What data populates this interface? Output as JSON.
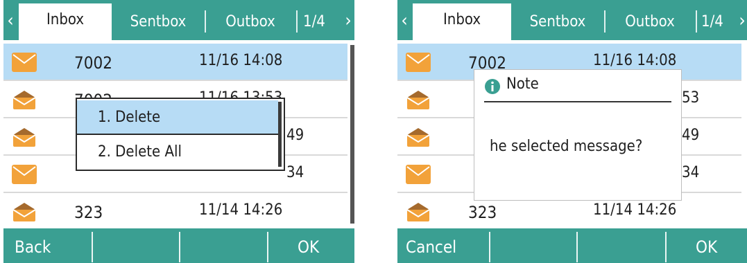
{
  "colors": {
    "accent": "#3a9f92",
    "selection": "#b7dcf5",
    "envelope_light": "#f2a23a",
    "envelope_dark": "#a56a2d"
  },
  "left": {
    "tabs": [
      "Inbox",
      "Sentbox",
      "Outbox"
    ],
    "page_indicator": "1/4",
    "messages": [
      {
        "sender": "7002",
        "time": "11/16 14:08",
        "icon": "envelope-unread-icon"
      },
      {
        "sender": "7002",
        "time": "11/16 13:53",
        "icon": "envelope-read-icon"
      },
      {
        "sender": "",
        "time": "49",
        "icon": "envelope-read-icon"
      },
      {
        "sender": "",
        "time": "34",
        "icon": "envelope-unread-icon"
      },
      {
        "sender": "323",
        "time": "11/14 14:26",
        "icon": "envelope-read-icon"
      }
    ],
    "menu": {
      "items": [
        "1. Delete",
        "2. Delete All"
      ]
    },
    "softkeys": {
      "left": "Back",
      "right": "OK"
    }
  },
  "right": {
    "tabs": [
      "Inbox",
      "Sentbox",
      "Outbox"
    ],
    "page_indicator": "1/4",
    "messages": [
      {
        "sender": "7002",
        "time": "11/16 14:08",
        "icon": "envelope-unread-icon"
      },
      {
        "sender": "",
        "time": "53",
        "icon": "envelope-read-icon"
      },
      {
        "sender": "",
        "time": "49",
        "icon": "envelope-read-icon"
      },
      {
        "sender": "",
        "time": "34",
        "icon": "envelope-unread-icon"
      },
      {
        "sender": "323",
        "time": "11/14 14:26",
        "icon": "envelope-read-icon"
      }
    ],
    "note": {
      "title": "Note",
      "message": "he selected message?"
    },
    "softkeys": {
      "left": "Cancel",
      "right": "OK"
    }
  }
}
